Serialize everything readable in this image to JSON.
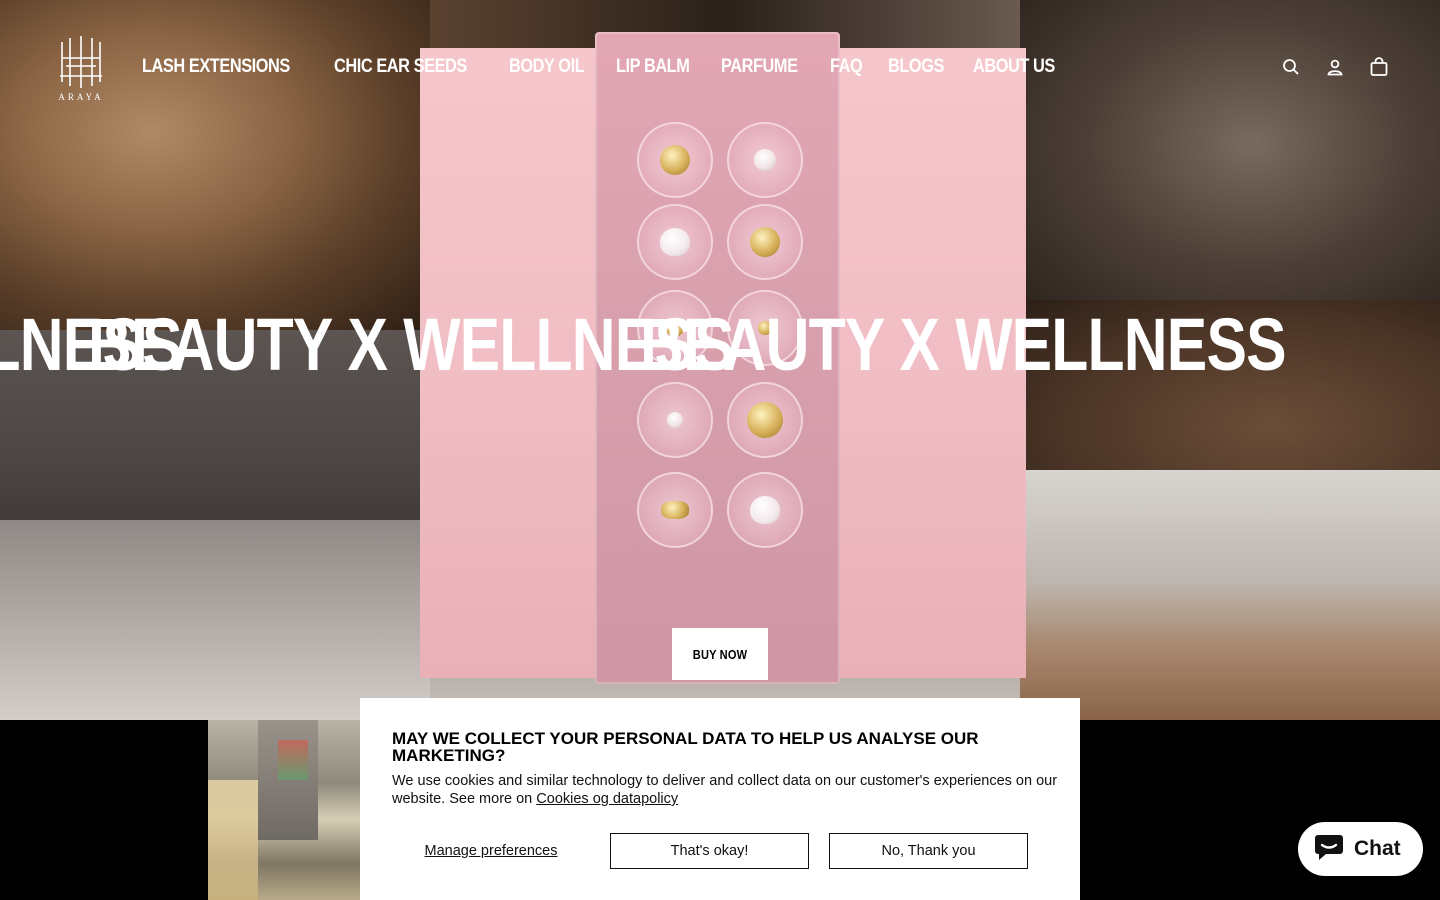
{
  "header": {
    "logo_text": "ARAYA",
    "nav": [
      {
        "label": "LASH EXTENSIONS"
      },
      {
        "label": "CHIC EAR SEEDS"
      },
      {
        "label": "BODY OIL"
      },
      {
        "label": "LIP BALM"
      },
      {
        "label": "PARFUME"
      },
      {
        "label": "FAQ"
      },
      {
        "label": "BLOGS"
      },
      {
        "label": "ABOUT US"
      }
    ],
    "icons": [
      "search-icon",
      "account-icon",
      "cart-icon"
    ]
  },
  "hero": {
    "marquee_text": "BEAUTY X WELLNESS",
    "buy_now_label": "BUY NOW"
  },
  "cookie_banner": {
    "title": "MAY WE COLLECT YOUR PERSONAL DATA TO HELP US ANALYSE OUR MARKETING?",
    "body": "We use cookies and similar technology to deliver and collect data on our customer's experiences on our website. See more on",
    "link_text": "Cookies og datapolicy",
    "manage_label": "Manage preferences",
    "accept_label": "That's okay!",
    "decline_label": "No, Thank you"
  },
  "chat": {
    "label": "Chat",
    "icon": "chat-bubble-icon"
  },
  "colors": {
    "product_pink": "#f5c6cb",
    "text_white": "#ffffff",
    "chat_icon_black": "#111111"
  }
}
